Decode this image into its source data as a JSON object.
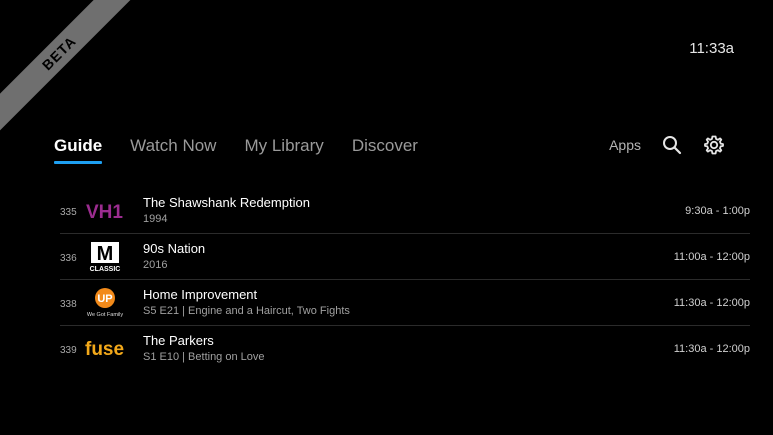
{
  "ribbon": {
    "label": "BETA"
  },
  "clock": "11:33a",
  "nav": {
    "tabs": [
      {
        "label": "Guide",
        "active": true
      },
      {
        "label": "Watch Now",
        "active": false
      },
      {
        "label": "My Library",
        "active": false
      },
      {
        "label": "Discover",
        "active": false
      }
    ],
    "apps_label": "Apps",
    "search_icon": "search-icon",
    "settings_icon": "gear-icon"
  },
  "colors": {
    "accent": "#1ea0f2",
    "background": "#000000",
    "vh1": "#9b2c8f",
    "up": "#f28a1a",
    "fuse": "#f2a81a"
  },
  "guide": {
    "rows": [
      {
        "channel": "335",
        "logo_text": "VH1",
        "title": "The Shawshank Redemption",
        "subtitle": "1994",
        "time": "9:30a - 1:00p"
      },
      {
        "channel": "336",
        "logo_text": "MTV CLASSIC",
        "logo_main": "M",
        "logo_sub": "CLASSIC",
        "title": "90s Nation",
        "subtitle": "2016",
        "time": "11:00a - 12:00p"
      },
      {
        "channel": "338",
        "logo_text": "UP We Got Family",
        "logo_main": "UP",
        "logo_sub": "We Got Family",
        "title": "Home Improvement",
        "subtitle": "S5 E21 | Engine and a Haircut, Two Fights",
        "time": "11:30a - 12:00p"
      },
      {
        "channel": "339",
        "logo_text": "fuse",
        "title": "The Parkers",
        "subtitle": "S1 E10 | Betting on Love",
        "time": "11:30a - 12:00p"
      }
    ]
  }
}
